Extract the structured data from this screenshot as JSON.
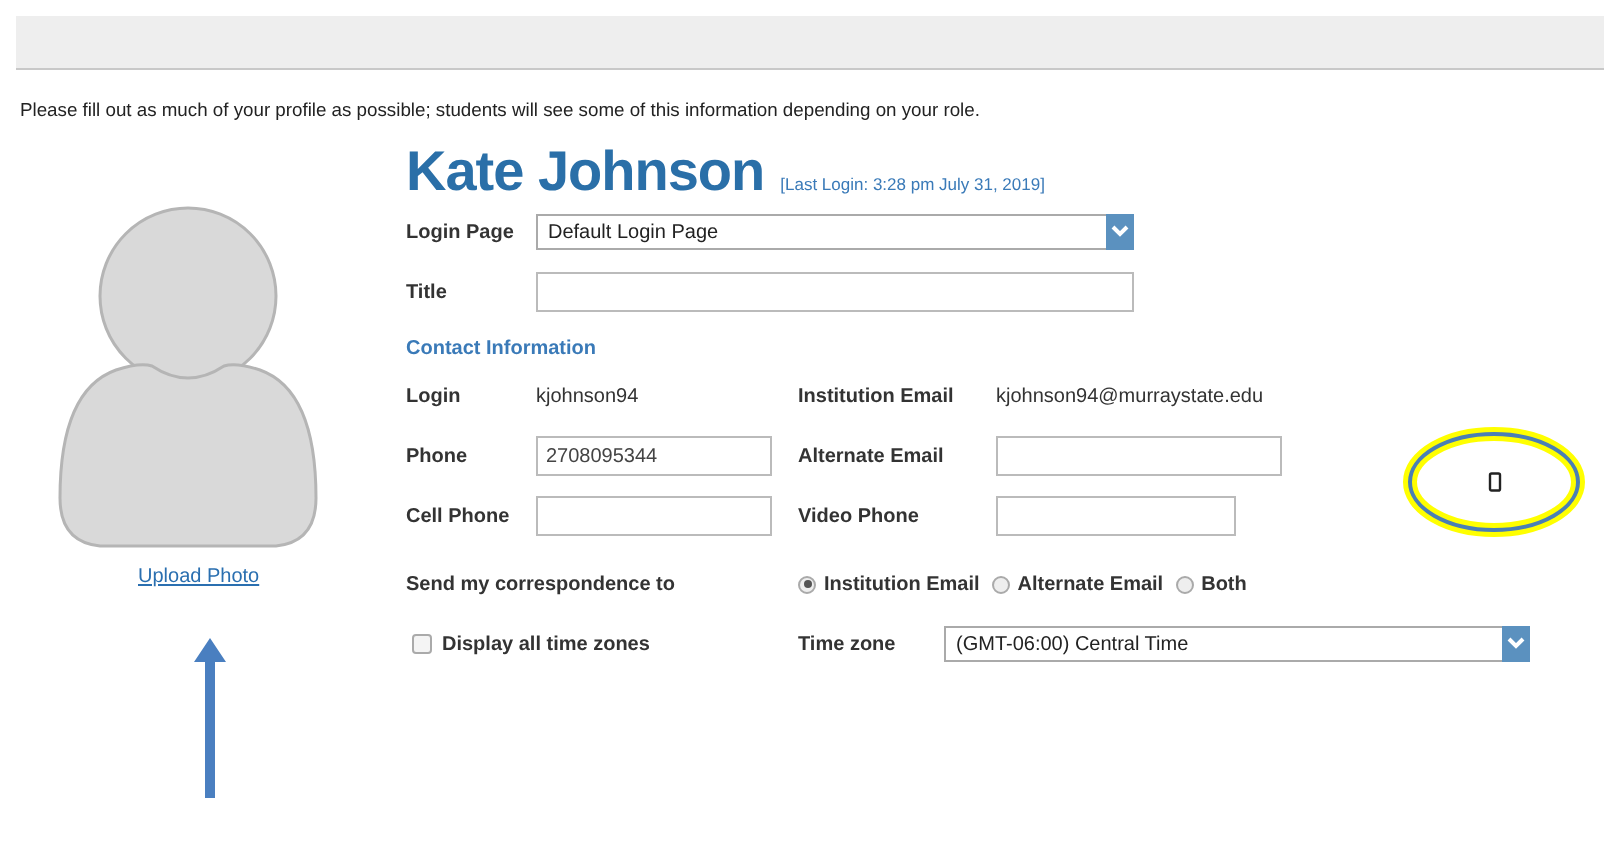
{
  "intro": "Please fill out as much of your profile as possible; students will see some of this information depending on your role.",
  "photo": {
    "link": "Upload Photo"
  },
  "profile": {
    "name": "Kate Johnson",
    "last_login": "[Last Login: 3:28 pm July 31, 2019]"
  },
  "fields": [
    {
      "label": "Login Page",
      "kind": "select",
      "value": "Default Login Page"
    },
    {
      "label": "Title",
      "kind": "input"
    }
  ],
  "contact": {
    "heading": "Contact Information",
    "rows": [
      [
        {
          "label": "Login",
          "kind": "text",
          "value": "kjohnson94"
        },
        {
          "label": "Institution Email",
          "kind": "text",
          "value": "kjohnson94@murraystate.edu"
        }
      ],
      [
        {
          "label": "Phone",
          "kind": "input",
          "value": "2708095344"
        },
        {
          "label": "Alternate Email",
          "kind": "input"
        }
      ],
      [
        {
          "label": "Cell Phone",
          "kind": "input"
        },
        {
          "label": "Video Phone",
          "kind": "input"
        }
      ]
    ]
  },
  "correspondence": {
    "label": "Send my correspondence to",
    "options": [
      {
        "label": "Institution Email",
        "selected": true
      },
      {
        "label": "Alternate Email",
        "selected": false
      },
      {
        "label": "Both",
        "selected": false
      }
    ]
  },
  "time": {
    "display_all": {
      "label": "Display all time zones",
      "checked": false
    },
    "label": "Time zone",
    "value": "(GMT-06:00) Central Time"
  }
}
